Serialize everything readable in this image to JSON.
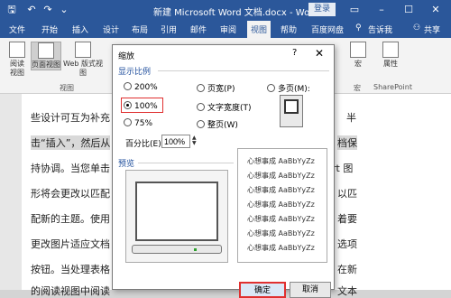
{
  "titlebar": {
    "title": "新建 Microsoft Word 文档.docx - Word",
    "login": "登录"
  },
  "tabs": [
    "文件",
    "开始",
    "插入",
    "设计",
    "布局",
    "引用",
    "邮件",
    "审阅",
    "视图",
    "帮助",
    "百度网盘",
    "告诉我",
    "共享"
  ],
  "ribbon": {
    "read_view": "阅读\n视图",
    "page_view": "页面视图",
    "web_view": "Web 版式视图",
    "group_label": "视图",
    "macro": "宏",
    "macro_group": "宏",
    "property": "属性",
    "sharepoint": "SharePoint"
  },
  "document": {
    "lines": [
      "些设计可互为补充",
      "击“插入”，然后从",
      "持协调。当您单击",
      "形将会更改以匹配",
      "配新的主题。使用",
      "更改图片适应文档",
      "按钮。当处理表格",
      "的阅读视图中阅读"
    ],
    "right_fragments": [
      "半",
      "档保",
      "rt 图",
      "以匹",
      "着要",
      "选项",
      "在新",
      "文本"
    ]
  },
  "dialog": {
    "title": "缩放",
    "help": "?",
    "close": "✕",
    "section_zoom": "显示比例",
    "opt_200": "200%",
    "opt_100": "100%",
    "opt_75": "75%",
    "opt_page_width": "页宽(P)",
    "opt_text_width": "文字宽度(T)",
    "opt_whole_page": "整页(W)",
    "opt_multi_page": "多页(M):",
    "percent_label": "百分比(E):",
    "percent_value": "100%",
    "section_preview": "预览",
    "sample_lines": [
      "心想事成 AaBbYyZz",
      "心想事成 AaBbYyZz",
      "心想事成 AaBbYyZz",
      "心想事成 AaBbYyZz",
      "心想事成 AaBbYyZz",
      "心想事成 AaBbYyZz",
      "心想事成 AaBbYyZz"
    ],
    "ok": "确定",
    "cancel": "取消"
  },
  "colors": {
    "titlebar": "#2b579a",
    "highlight": "#e03030"
  }
}
